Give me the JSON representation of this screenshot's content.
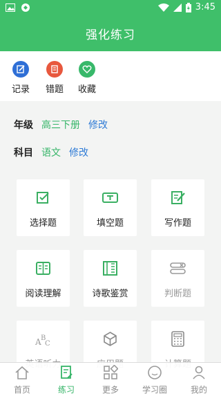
{
  "status": {
    "time": "3:45"
  },
  "header": {
    "title": "强化练习"
  },
  "shortcuts": [
    {
      "label": "记录",
      "icon": "edit-record-icon",
      "color": "#2f6fd6"
    },
    {
      "label": "错题",
      "icon": "wrong-answers-icon",
      "color": "#e8583e"
    },
    {
      "label": "收藏",
      "icon": "heart-favorite-icon",
      "color": "#38b86a"
    }
  ],
  "settings": {
    "grade": {
      "key": "年级",
      "value": "高三下册",
      "edit": "修改"
    },
    "subject": {
      "key": "科目",
      "value": "语文",
      "edit": "修改"
    }
  },
  "exercise_types": [
    {
      "label": "选择题",
      "icon": "checkbox-icon",
      "enabled": true
    },
    {
      "label": "填空题",
      "icon": "fill-blank-icon",
      "enabled": true
    },
    {
      "label": "写作题",
      "icon": "write-pencil-icon",
      "enabled": true
    },
    {
      "label": "阅读理解",
      "icon": "open-book-icon",
      "enabled": true
    },
    {
      "label": "诗歌鉴赏",
      "icon": "scroll-poem-icon",
      "enabled": true
    },
    {
      "label": "判断题",
      "icon": "true-false-icon",
      "enabled": false
    },
    {
      "label": "英语听力",
      "icon": "abc-letters-icon",
      "enabled": false
    },
    {
      "label": "应用题",
      "icon": "cube-icon",
      "enabled": false
    },
    {
      "label": "计算题",
      "icon": "calculator-icon",
      "enabled": false
    }
  ],
  "tabbar": [
    {
      "label": "首页",
      "icon": "home-icon",
      "active": false
    },
    {
      "label": "练习",
      "icon": "practice-icon",
      "active": true
    },
    {
      "label": "更多",
      "icon": "grid-more-icon",
      "active": false
    },
    {
      "label": "学习圈",
      "icon": "chat-circle-icon",
      "active": false
    },
    {
      "label": "我的",
      "icon": "person-icon",
      "active": false
    }
  ],
  "colors": {
    "primary": "#3fbf6a",
    "link": "#2f7bd6"
  }
}
